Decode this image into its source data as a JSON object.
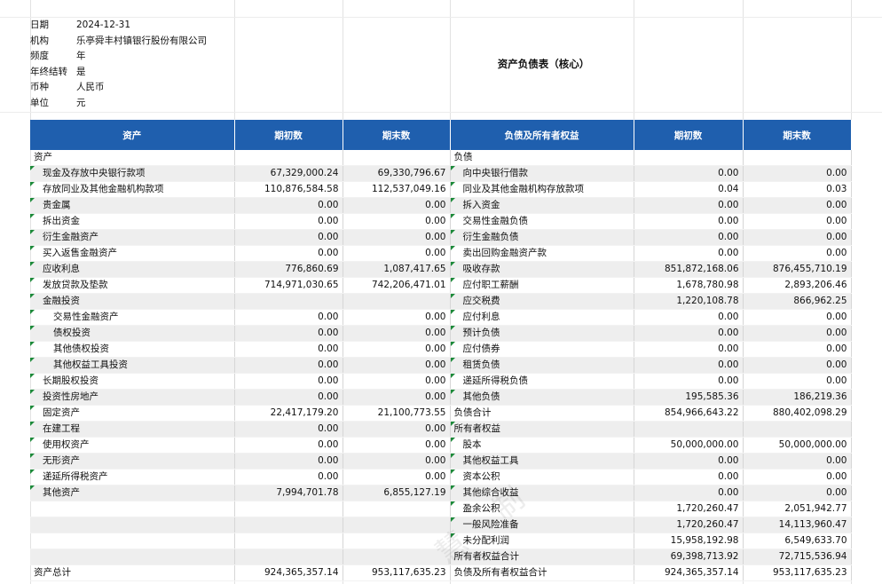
{
  "meta": [
    {
      "label": "日期",
      "value": "2024-12-31"
    },
    {
      "label": "机构",
      "value": "乐亭舜丰村镇银行股份有限公司"
    },
    {
      "label": "频度",
      "value": "年"
    },
    {
      "label": "年终结转",
      "value": "是"
    },
    {
      "label": "币种",
      "value": "人民币"
    },
    {
      "label": "单位",
      "value": "元"
    }
  ],
  "title": "资产负债表（核心）",
  "headers": [
    "资产",
    "期初数",
    "期末数",
    "负债及所有者权益",
    "期初数",
    "期末数"
  ],
  "rows": [
    {
      "a": "资产",
      "ai": 0,
      "ab": "",
      "ae": "",
      "l": "负债",
      "li": 0,
      "lb": "",
      "le": "",
      "shade": false,
      "at": false,
      "lt": false
    },
    {
      "a": "现金及存放中央银行款项",
      "ai": 1,
      "ab": "67,329,000.24",
      "ae": "69,330,796.67",
      "l": "向中央银行借款",
      "li": 1,
      "lb": "0.00",
      "le": "0.00",
      "shade": true,
      "at": true,
      "lt": true
    },
    {
      "a": "存放同业及其他金融机构款项",
      "ai": 1,
      "ab": "110,876,584.58",
      "ae": "112,537,049.16",
      "l": "同业及其他金融机构存放款项",
      "li": 1,
      "lb": "0.04",
      "le": "0.03",
      "shade": false,
      "at": true,
      "lt": true
    },
    {
      "a": "贵金属",
      "ai": 1,
      "ab": "0.00",
      "ae": "0.00",
      "l": "拆入资金",
      "li": 1,
      "lb": "0.00",
      "le": "0.00",
      "shade": true,
      "at": true,
      "lt": true
    },
    {
      "a": "拆出资金",
      "ai": 1,
      "ab": "0.00",
      "ae": "0.00",
      "l": "交易性金融负债",
      "li": 1,
      "lb": "0.00",
      "le": "0.00",
      "shade": false,
      "at": true,
      "lt": true
    },
    {
      "a": "衍生金融资产",
      "ai": 1,
      "ab": "0.00",
      "ae": "0.00",
      "l": "衍生金融负债",
      "li": 1,
      "lb": "0.00",
      "le": "0.00",
      "shade": true,
      "at": true,
      "lt": true
    },
    {
      "a": "买入返售金融资产",
      "ai": 1,
      "ab": "0.00",
      "ae": "0.00",
      "l": "卖出回购金融资产款",
      "li": 1,
      "lb": "0.00",
      "le": "0.00",
      "shade": false,
      "at": true,
      "lt": true
    },
    {
      "a": "应收利息",
      "ai": 1,
      "ab": "776,860.69",
      "ae": "1,087,417.65",
      "l": "吸收存款",
      "li": 1,
      "lb": "851,872,168.06",
      "le": "876,455,710.19",
      "shade": true,
      "at": true,
      "lt": true
    },
    {
      "a": "发放贷款及垫款",
      "ai": 1,
      "ab": "714,971,030.65",
      "ae": "742,206,471.01",
      "l": "应付职工薪酬",
      "li": 1,
      "lb": "1,678,780.98",
      "le": "2,893,206.46",
      "shade": false,
      "at": true,
      "lt": true
    },
    {
      "a": "金融投资",
      "ai": 1,
      "ab": "",
      "ae": "",
      "l": "应交税费",
      "li": 1,
      "lb": "1,220,108.78",
      "le": "866,962.25",
      "shade": true,
      "at": true,
      "lt": true
    },
    {
      "a": "交易性金融资产",
      "ai": 2,
      "ab": "0.00",
      "ae": "0.00",
      "l": "应付利息",
      "li": 1,
      "lb": "0.00",
      "le": "0.00",
      "shade": false,
      "at": true,
      "lt": true
    },
    {
      "a": "债权投资",
      "ai": 2,
      "ab": "0.00",
      "ae": "0.00",
      "l": "预计负债",
      "li": 1,
      "lb": "0.00",
      "le": "0.00",
      "shade": true,
      "at": true,
      "lt": true
    },
    {
      "a": "其他债权投资",
      "ai": 2,
      "ab": "0.00",
      "ae": "0.00",
      "l": "应付债券",
      "li": 1,
      "lb": "0.00",
      "le": "0.00",
      "shade": false,
      "at": true,
      "lt": true
    },
    {
      "a": "其他权益工具投资",
      "ai": 2,
      "ab": "0.00",
      "ae": "0.00",
      "l": "租赁负债",
      "li": 1,
      "lb": "0.00",
      "le": "0.00",
      "shade": true,
      "at": true,
      "lt": true
    },
    {
      "a": "长期股权投资",
      "ai": 1,
      "ab": "0.00",
      "ae": "0.00",
      "l": "递延所得税负债",
      "li": 1,
      "lb": "0.00",
      "le": "0.00",
      "shade": false,
      "at": true,
      "lt": true
    },
    {
      "a": "投资性房地产",
      "ai": 1,
      "ab": "0.00",
      "ae": "0.00",
      "l": "其他负债",
      "li": 1,
      "lb": "195,585.36",
      "le": "186,219.36",
      "shade": true,
      "at": true,
      "lt": true
    },
    {
      "a": "固定资产",
      "ai": 1,
      "ab": "22,417,179.20",
      "ae": "21,100,773.55",
      "l": "负债合计",
      "li": 0,
      "lb": "854,966,643.22",
      "le": "880,402,098.29",
      "shade": false,
      "at": true,
      "lt": false
    },
    {
      "a": "在建工程",
      "ai": 1,
      "ab": "0.00",
      "ae": "0.00",
      "l": "所有者权益",
      "li": 0,
      "lb": "",
      "le": "",
      "shade": true,
      "at": true,
      "lt": true
    },
    {
      "a": "使用权资产",
      "ai": 1,
      "ab": "0.00",
      "ae": "0.00",
      "l": "股本",
      "li": 1,
      "lb": "50,000,000.00",
      "le": "50,000,000.00",
      "shade": false,
      "at": true,
      "lt": true
    },
    {
      "a": "无形资产",
      "ai": 1,
      "ab": "0.00",
      "ae": "0.00",
      "l": "其他权益工具",
      "li": 1,
      "lb": "0.00",
      "le": "0.00",
      "shade": true,
      "at": true,
      "lt": true
    },
    {
      "a": "递延所得税资产",
      "ai": 1,
      "ab": "0.00",
      "ae": "0.00",
      "l": "资本公积",
      "li": 1,
      "lb": "0.00",
      "le": "0.00",
      "shade": false,
      "at": true,
      "lt": true
    },
    {
      "a": "其他资产",
      "ai": 1,
      "ab": "7,994,701.78",
      "ae": "6,855,127.19",
      "l": "其他综合收益",
      "li": 1,
      "lb": "0.00",
      "le": "0.00",
      "shade": true,
      "at": true,
      "lt": true
    },
    {
      "a": "",
      "ai": 0,
      "ab": "",
      "ae": "",
      "l": "盈余公积",
      "li": 1,
      "lb": "1,720,260.47",
      "le": "2,051,942.77",
      "shade": false,
      "at": false,
      "lt": true
    },
    {
      "a": "",
      "ai": 0,
      "ab": "",
      "ae": "",
      "l": "一般风险准备",
      "li": 1,
      "lb": "1,720,260.47",
      "le": "14,113,960.47",
      "shade": true,
      "at": false,
      "lt": true
    },
    {
      "a": "",
      "ai": 0,
      "ab": "",
      "ae": "",
      "l": "未分配利润",
      "li": 1,
      "lb": "15,958,192.98",
      "le": "6,549,633.70",
      "shade": false,
      "at": false,
      "lt": true
    },
    {
      "a": "",
      "ai": 0,
      "ab": "",
      "ae": "",
      "l": "所有者权益合计",
      "li": 0,
      "lb": "69,398,713.92",
      "le": "72,715,536.94",
      "shade": true,
      "at": false,
      "lt": false
    },
    {
      "a": "资产总计",
      "ai": 0,
      "ab": "924,365,357.14",
      "ae": "953,117,635.23",
      "l": "负债及所有者权益合计",
      "li": 0,
      "lb": "924,365,357.14",
      "le": "953,117,635.23",
      "shade": false,
      "at": false,
      "lt": false
    }
  ]
}
